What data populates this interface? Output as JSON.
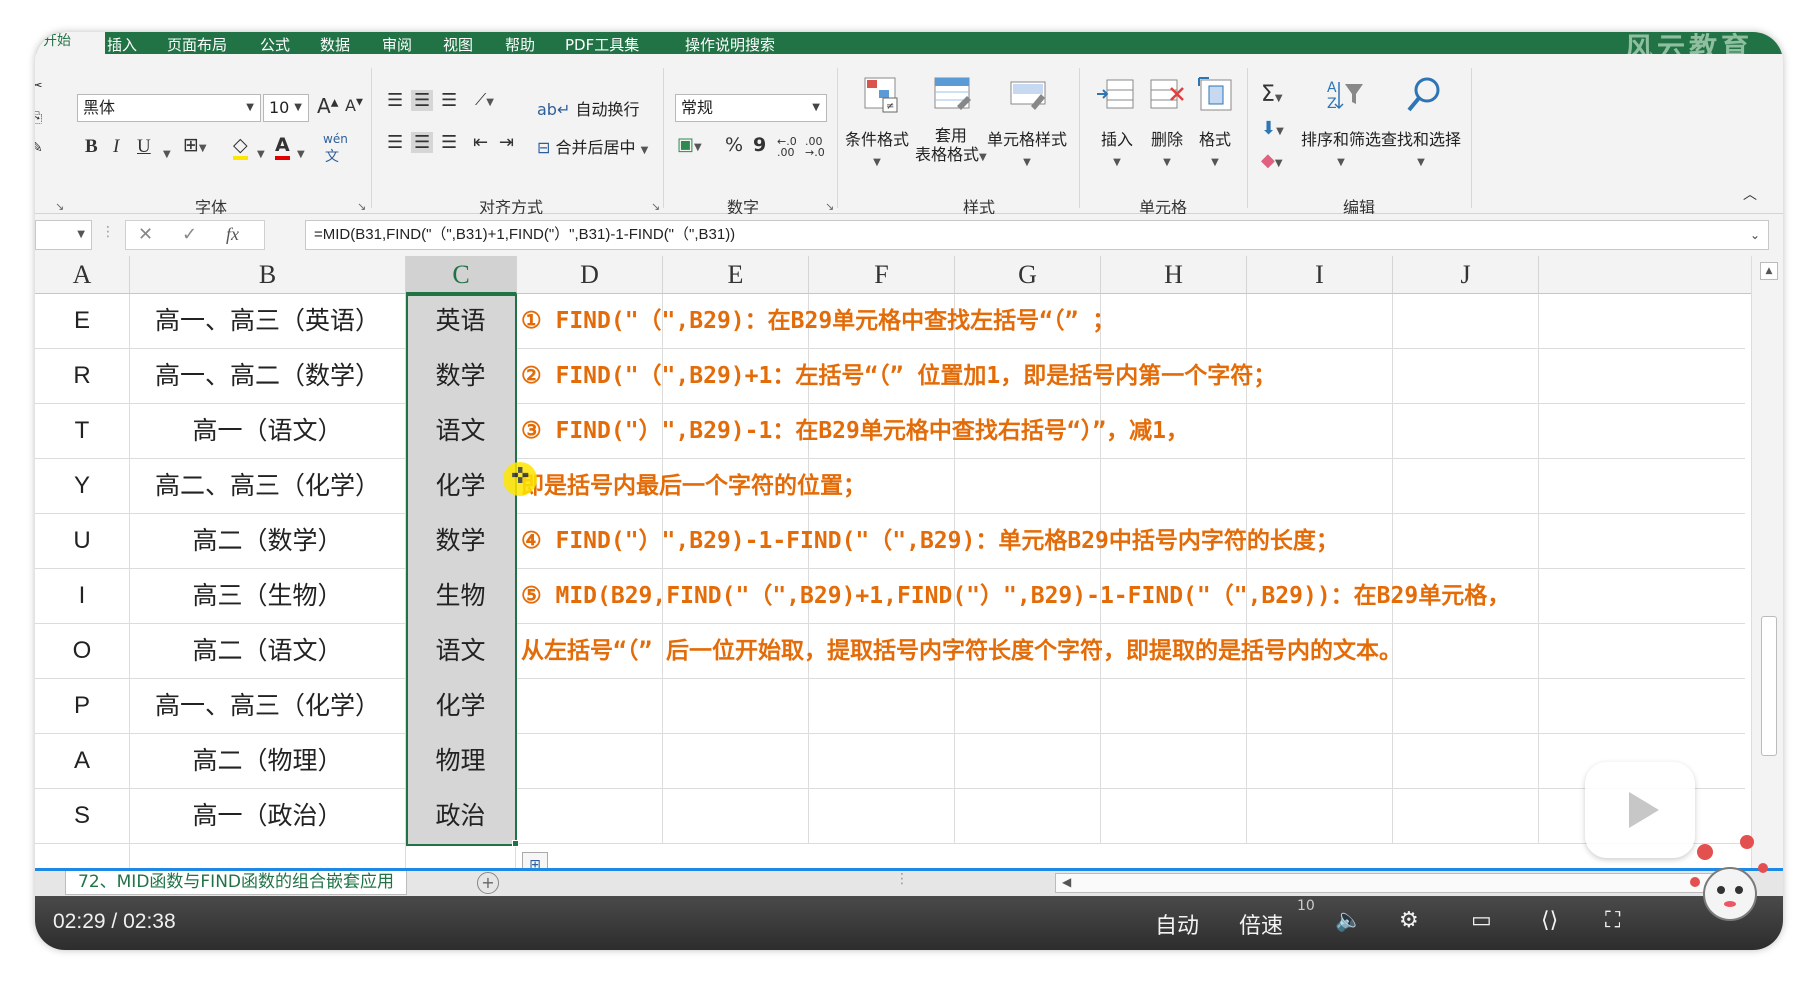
{
  "ribbon": {
    "tabs": [
      "插入",
      "页面布局",
      "公式",
      "数据",
      "审阅",
      "视图",
      "帮助",
      "PDF工具集",
      "操作说明搜索"
    ],
    "file_tab": "开始",
    "brand": "风云教育",
    "font": {
      "name": "黑体",
      "size": "10",
      "grow": "A",
      "shrink": "A",
      "bold": "B",
      "italic": "I",
      "underline": "U",
      "phonetic": "wén",
      "group_label": "字体"
    },
    "alignment": {
      "wrap_text": "自动换行",
      "merge_center": "合并后居中",
      "group_label": "对齐方式"
    },
    "number": {
      "format": "常规",
      "percent": "%",
      "comma": "9",
      "inc_decimal": "←.0\n.00",
      "dec_decimal": ".00\n→.0",
      "group_label": "数字"
    },
    "styles": {
      "conditional": "条件格式",
      "table_l1": "套用",
      "table_l2": "表格格式",
      "cell_styles": "单元格样式",
      "group_label": "样式"
    },
    "cells": {
      "insert": "插入",
      "delete": "删除",
      "format": "格式",
      "group_label": "单元格"
    },
    "editing": {
      "sum": "Σ",
      "sort": "排序和筛选",
      "find": "查找和选择",
      "group_label": "编辑"
    }
  },
  "formula_bar": {
    "fx": "fx",
    "cancel": "✕",
    "confirm": "✓",
    "formula": "=MID(B31,FIND(\"（\",B31)+1,FIND(\"）\",B31)-1-FIND(\"（\",B31))"
  },
  "columns": [
    "A",
    "B",
    "C",
    "D",
    "E",
    "F",
    "G",
    "H",
    "I",
    "J"
  ],
  "rows": [
    {
      "a": "E",
      "b": "高一、高三（英语）",
      "c": "英语",
      "note": "①  FIND(\"（\",B29)：在B29单元格中查找左括号“（”  ；"
    },
    {
      "a": "R",
      "b": "高一、高二（数学）",
      "c": "数学",
      "note": "②  FIND(\"（\",B29)+1：左括号“（” 位置加1，即是括号内第一个字符；"
    },
    {
      "a": "T",
      "b": "高一（语文）",
      "c": "语文",
      "note": "③  FIND(\"）\",B29)-1：在B29单元格中查找右括号“）”，减1，"
    },
    {
      "a": "Y",
      "b": "高二、高三（化学）",
      "c": "化学",
      "note": "即是括号内最后一个字符的位置；"
    },
    {
      "a": "U",
      "b": "高二（数学）",
      "c": "数学",
      "note": "④  FIND(\"）\",B29)-1-FIND(\"（\",B29)：单元格B29中括号内字符的长度；"
    },
    {
      "a": "I",
      "b": "高三（生物）",
      "c": "生物",
      "note": "⑤  MID(B29,FIND(\"（\",B29)+1,FIND(\"）\",B29)-1-FIND(\"（\",B29))：在B29单元格，"
    },
    {
      "a": "O",
      "b": "高二（语文）",
      "c": "语文",
      "note": "从左括号“（” 后一位开始取，提取括号内字符长度个字符，即提取的是括号内的文本。"
    },
    {
      "a": "P",
      "b": "高一、高三（化学）",
      "c": "化学",
      "note": ""
    },
    {
      "a": "A",
      "b": "高二（物理）",
      "c": "物理",
      "note": ""
    },
    {
      "a": "S",
      "b": "高一（政治）",
      "c": "政治",
      "note": ""
    }
  ],
  "sheet": {
    "tab_name": "72、MID函数与FIND函数的组合嵌套应用",
    "add": "+"
  },
  "player": {
    "current_time": "02:29",
    "separator": "/",
    "total_time": "02:38",
    "auto": "自动",
    "speed": "倍速",
    "zoom": "10"
  },
  "colors": {
    "excel_green": "#217346",
    "note_orange": "#e36c09",
    "selected_col_bg": "#d6d6d6"
  }
}
